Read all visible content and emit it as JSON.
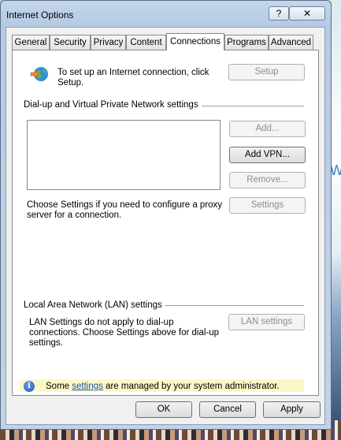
{
  "window": {
    "title": "Internet Options",
    "help_glyph": "?",
    "close_glyph": "✕"
  },
  "tabs": [
    {
      "label": "General"
    },
    {
      "label": "Security"
    },
    {
      "label": "Privacy"
    },
    {
      "label": "Content"
    },
    {
      "label": "Connections",
      "active": true
    },
    {
      "label": "Programs"
    },
    {
      "label": "Advanced"
    }
  ],
  "setup": {
    "text": "To set up an Internet connection, click Setup.",
    "button": "Setup"
  },
  "dialup": {
    "group_label": "Dial-up and Virtual Private Network settings",
    "add_button": "Add...",
    "add_vpn_button": "Add VPN...",
    "remove_button": "Remove...",
    "proxy_text": "Choose Settings if you need to configure a proxy server for a connection.",
    "settings_button": "Settings"
  },
  "lan": {
    "group_label": "Local Area Network (LAN) settings",
    "text": "LAN Settings do not apply to dial-up connections. Choose Settings above for dial-up settings.",
    "button": "LAN settings"
  },
  "admin_notice": {
    "before": "Some ",
    "link": "settings",
    "after": " are managed by your system administrator."
  },
  "footer": {
    "ok": "OK",
    "cancel": "Cancel",
    "apply": "Apply"
  }
}
